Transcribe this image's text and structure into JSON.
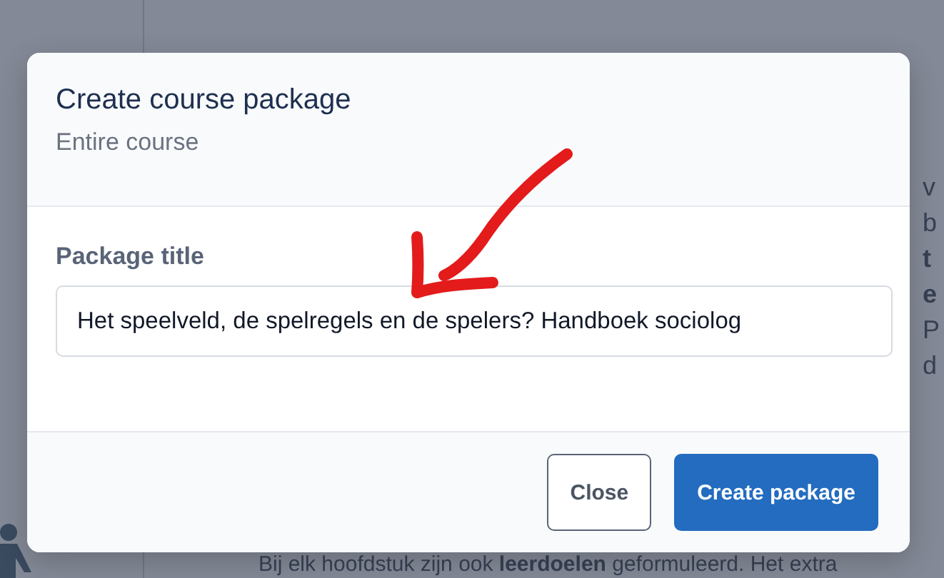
{
  "background": {
    "side_fragments": [
      "v",
      "b",
      "t",
      "e",
      "P",
      "d"
    ],
    "bottom_text": "Bij elk hoofdstuk zijn ook **leerdoelen** geformuleerd. Het extra"
  },
  "dialog": {
    "title": "Create course package",
    "subtitle": "Entire course",
    "field": {
      "label": "Package title",
      "value": "Het speelveld, de spelregels en de spelers? Handboek sociolog"
    },
    "buttons": [
      {
        "label": "Close",
        "kind": "secondary"
      },
      {
        "label": "Create package",
        "kind": "primary"
      }
    ]
  },
  "annotation": {
    "kind": "arrow"
  }
}
